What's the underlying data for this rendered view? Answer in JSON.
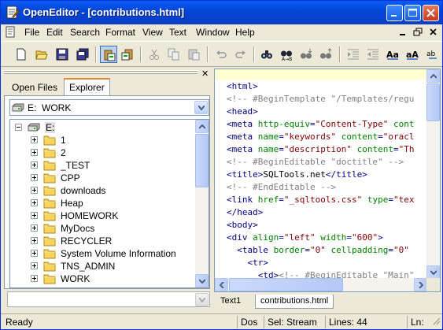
{
  "window": {
    "title": "OpenEditor - [contributions.html]"
  },
  "menu": {
    "items": [
      "File",
      "Edit",
      "Search",
      "Format",
      "View",
      "Text",
      "Window",
      "Help"
    ]
  },
  "toolbar": {
    "buttons": [
      "new-document",
      "open-folder",
      "save",
      "save-all",
      "clipboard-paste-special",
      "clipboard-copy-special",
      "cut",
      "copy",
      "paste",
      "undo",
      "redo",
      "find",
      "find-replace",
      "find-next",
      "find-previous",
      "indent",
      "outdent",
      "uppercase",
      "lowercase",
      "column-mode"
    ]
  },
  "left_pane": {
    "tabs": [
      "Open Files",
      "Explorer"
    ],
    "active_tab": "Explorer",
    "drive": {
      "letter": "E:",
      "label": "WORK"
    },
    "tree": {
      "root": "E:",
      "folders": [
        "1",
        "2",
        "_TEST",
        "CPP",
        "downloads",
        "Heap",
        "HOMEWORK",
        "MyDocs",
        "RECYCLER",
        "System Volume Information",
        "TNS_ADMIN",
        "WORK"
      ]
    }
  },
  "editor": {
    "lines": [
      [
        {
          "t": "<",
          "c": "tag"
        },
        {
          "t": "html",
          "c": "tag"
        },
        {
          "t": ">",
          "c": "tag"
        }
      ],
      [
        {
          "t": "<!-- #BeginTemplate \"/Templates/regu",
          "c": "cmt"
        }
      ],
      [
        {
          "t": "<head>",
          "c": "tag"
        }
      ],
      [
        {
          "t": "<meta ",
          "c": "tag"
        },
        {
          "t": "http-equiv",
          "c": "attr"
        },
        {
          "t": "=",
          "c": "tag"
        },
        {
          "t": "\"Content-Type\"",
          "c": "val"
        },
        {
          "t": " cont",
          "c": "attr"
        }
      ],
      [
        {
          "t": "<meta ",
          "c": "tag"
        },
        {
          "t": "name",
          "c": "attr"
        },
        {
          "t": "=",
          "c": "tag"
        },
        {
          "t": "\"keywords\"",
          "c": "val"
        },
        {
          "t": " content",
          "c": "attr"
        },
        {
          "t": "=",
          "c": "tag"
        },
        {
          "t": "\"oracl",
          "c": "val"
        }
      ],
      [
        {
          "t": "<meta ",
          "c": "tag"
        },
        {
          "t": "name",
          "c": "attr"
        },
        {
          "t": "=",
          "c": "tag"
        },
        {
          "t": "\"description\"",
          "c": "val"
        },
        {
          "t": " content",
          "c": "attr"
        },
        {
          "t": "=",
          "c": "tag"
        },
        {
          "t": "\"Th",
          "c": "val"
        }
      ],
      [
        {
          "t": "<!-- #BeginEditable \"doctitle\" -->",
          "c": "cmt"
        }
      ],
      [
        {
          "t": "<title>",
          "c": "tag"
        },
        {
          "t": "SQLTools.net",
          "c": ""
        },
        {
          "t": "</title>",
          "c": "tag"
        }
      ],
      [
        {
          "t": "<!-- #EndEditable -->",
          "c": "cmt"
        }
      ],
      [
        {
          "t": "<link ",
          "c": "tag"
        },
        {
          "t": "href",
          "c": "attr"
        },
        {
          "t": "=",
          "c": "tag"
        },
        {
          "t": "\"_sqltools.css\"",
          "c": "val"
        },
        {
          "t": " type",
          "c": "attr"
        },
        {
          "t": "=",
          "c": "tag"
        },
        {
          "t": "\"tex",
          "c": "val"
        }
      ],
      [
        {
          "t": "</head>",
          "c": "tag"
        }
      ],
      [
        {
          "t": "<body>",
          "c": "tag"
        }
      ],
      [
        {
          "t": "<div ",
          "c": "tag"
        },
        {
          "t": "align",
          "c": "attr"
        },
        {
          "t": "=",
          "c": "tag"
        },
        {
          "t": "\"left\"",
          "c": "val"
        },
        {
          "t": " width",
          "c": "attr"
        },
        {
          "t": "=",
          "c": "tag"
        },
        {
          "t": "\"600\"",
          "c": "val"
        },
        {
          "t": ">",
          "c": "tag"
        }
      ],
      [
        {
          "t": "  <table ",
          "c": "tag"
        },
        {
          "t": "border",
          "c": "attr"
        },
        {
          "t": "=",
          "c": "tag"
        },
        {
          "t": "\"0\"",
          "c": "val"
        },
        {
          "t": " cellpadding",
          "c": "attr"
        },
        {
          "t": "=",
          "c": "tag"
        },
        {
          "t": "\"0\"",
          "c": "val"
        }
      ],
      [
        {
          "t": "    <tr>",
          "c": "tag"
        }
      ],
      [
        {
          "t": "      <td>",
          "c": "tag"
        },
        {
          "t": "<!-- #BeginEditable \"Main\"",
          "c": "cmt"
        }
      ]
    ]
  },
  "document_tabs": [
    "Text1",
    "contributions.html"
  ],
  "active_document_tab": "contributions.html",
  "status": {
    "state": "Ready",
    "eol": "Dos",
    "selection": "Sel: Stream",
    "lines": "Lines: 44",
    "position": "Ln:"
  },
  "colors": {
    "titlebar": "#0a5df6",
    "tag": "#000080",
    "attribute": "#008000",
    "value": "#800000",
    "comment": "#808080",
    "current_line": "#ffffd0"
  }
}
